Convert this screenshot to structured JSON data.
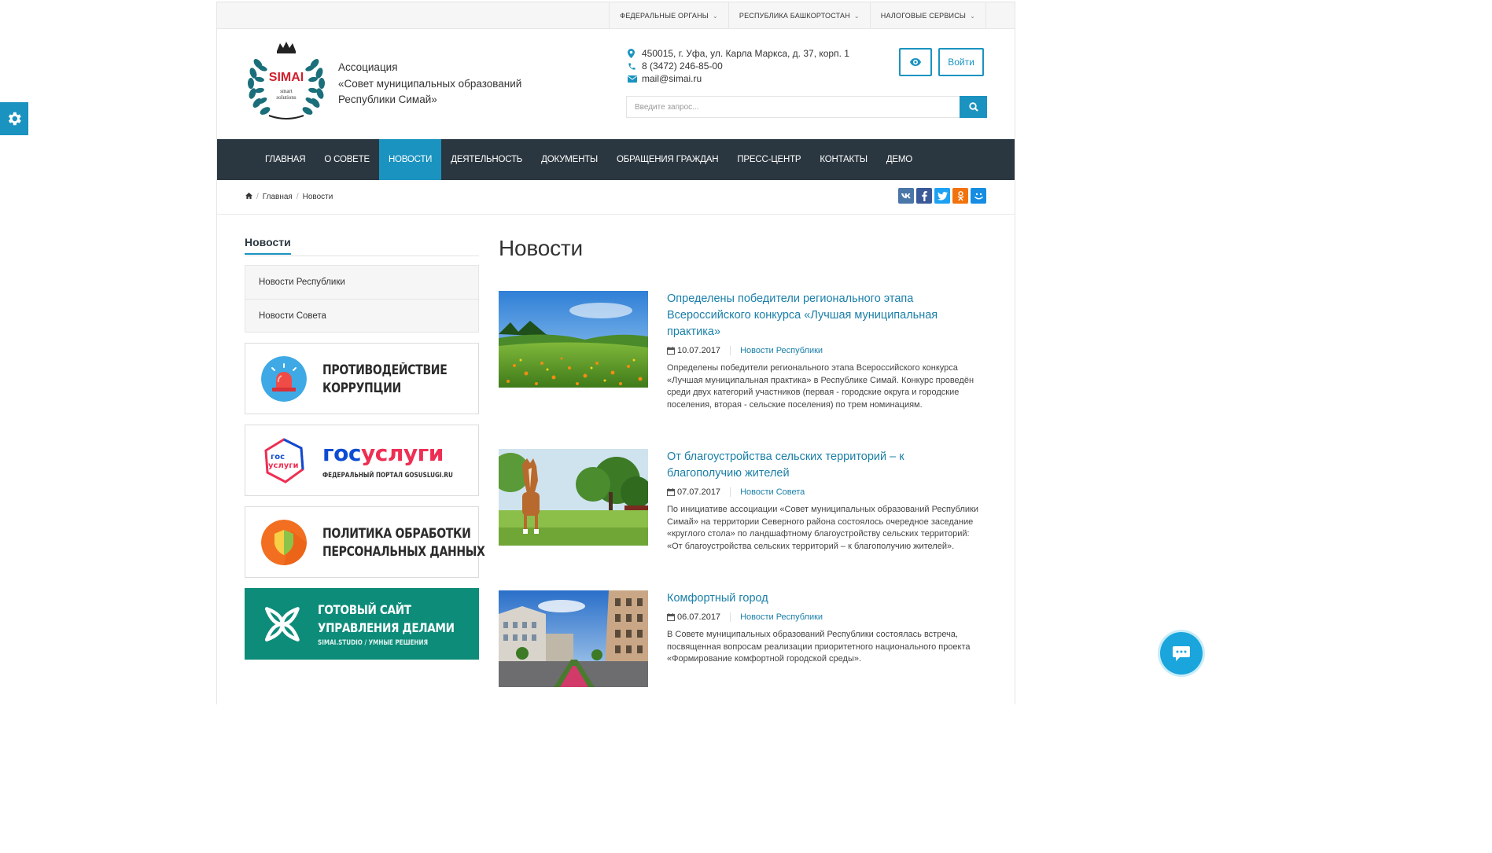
{
  "topbar": {
    "items": [
      {
        "label": "ФЕДЕРАЛЬНЫЕ ОРГАНЫ"
      },
      {
        "label": "РЕСПУБЛИКА БАШКОРТОСТАН"
      },
      {
        "label": "НАЛОГОВЫЕ СЕРВИСЫ"
      }
    ]
  },
  "header": {
    "logo_text": "SIMAI",
    "logo_subtext": "smart solutions",
    "org_line1": "Ассоциация",
    "org_line2": "«Совет муниципальных образований",
    "org_line3": "Республики Симай»",
    "address": "450015, г. Уфа, ул. Карла Маркса, д. 37, корп. 1",
    "phone": "8 (3472) 246-85-00",
    "email": "mail@simai.ru",
    "login_label": "Войти",
    "search_placeholder": "Введите запрос..."
  },
  "nav": {
    "items": [
      {
        "label": "ГЛАВНАЯ"
      },
      {
        "label": "О СОВЕТЕ"
      },
      {
        "label": "НОВОСТИ"
      },
      {
        "label": "ДЕЯТЕЛЬНОСТЬ"
      },
      {
        "label": "ДОКУМЕНТЫ"
      },
      {
        "label": "ОБРАЩЕНИЯ ГРАЖДАН"
      },
      {
        "label": "ПРЕСС-ЦЕНТР"
      },
      {
        "label": "КОНТАКТЫ"
      },
      {
        "label": "ДЕМО"
      }
    ],
    "active": "НОВОСТИ"
  },
  "breadcrumb": {
    "items": [
      "Главная",
      "Новости"
    ]
  },
  "social": [
    "vk",
    "facebook",
    "twitter",
    "odnoklassniki",
    "moimir"
  ],
  "sidebar": {
    "title": "Новости",
    "items": [
      {
        "label": "Новости Республики"
      },
      {
        "label": "Новости Совета"
      }
    ],
    "banners": {
      "corruption": {
        "line1": "ПРОТИВОДЕЙСТВИЕ",
        "line2": "КОРРУПЦИИ"
      },
      "gosuslugi": {
        "main_blue": "гос",
        "main_red": "услуги",
        "sub": "ФЕДЕРАЛЬНЫЙ ПОРТАЛ GOSUSLUGI.RU",
        "badge_line1": "гос",
        "badge_line2": "услуги"
      },
      "personal": {
        "line1": "ПОЛИТИКА ОБРАБОТКИ",
        "line2": "ПЕРСОНАЛЬНЫХ ДАННЫХ"
      },
      "simai": {
        "line1": "ГОТОВЫЙ САЙТ",
        "line2": "УПРАВЛЕНИЯ ДЕЛАМИ",
        "sub": "SIMAI.STUDIO / УМНЫЕ РЕШЕНИЯ"
      }
    }
  },
  "content": {
    "title": "Новости",
    "news": [
      {
        "title": "Определены победители регионального этапа Всероссийского конкурса «Лучшая муниципальная практика»",
        "date": "10.07.2017",
        "category": "Новости Республики",
        "text": "Определены победители регионального этапа Всероссийского конкурса «Лучшая муниципальная практика» в Республике Симай. Конкурс проведён среди двух категорий участников (первая - городские округа и городские поселения, вторая - сельские поселения) по трем номинациям."
      },
      {
        "title": "От благоустройства сельских территорий – к благополучию жителей",
        "date": "07.07.2017",
        "category": "Новости Совета",
        "text": "По инициативе ассоциации «Совет муниципальных образований Республики Симай» на территории Северного района состоялось очередное заседание «круглого стола» по ландшафтному благоустройству сельских территорий: «От благоустройства сельских территорий – к благополучию жителей»."
      },
      {
        "title": "Комфортный город",
        "date": "06.07.2017",
        "category": "Новости Республики",
        "text": "В Совете муниципальных образований Республики состоялась встреча, посвященная вопросам реализации приоритетного национального проекта «Формирование комфортной городской среды»."
      }
    ]
  },
  "colors": {
    "accent": "#1a93c0",
    "nav_bg": "#2b3740",
    "link": "#1a7fa8",
    "green_banner": "#0d8c7a"
  }
}
